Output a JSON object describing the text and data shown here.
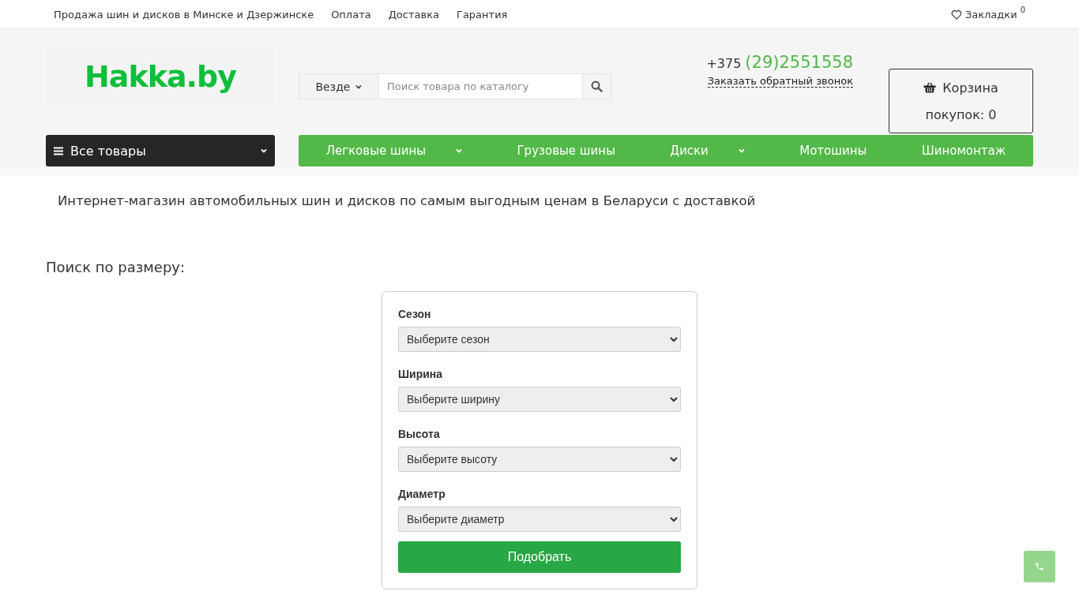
{
  "top_bar": {
    "links": [
      "Продажа шин и дисков в Минске и Дзержинске",
      "Оплата",
      "Доставка",
      "Гарантия"
    ],
    "bookmarks": {
      "label": "Закладки",
      "count": "0"
    }
  },
  "header": {
    "logo": "Hakka.by",
    "search": {
      "scope": "Везде",
      "placeholder": "Поиск товара по каталогу"
    },
    "phone": {
      "prefix": "+375",
      "number": "(29)2551558"
    },
    "callback_link": "Заказать обратный звонок",
    "cart": {
      "title": "Корзина",
      "count_text": "покупок: 0"
    }
  },
  "catalog_button": "Все товары",
  "nav": [
    {
      "label": "Легковые шины",
      "has_dropdown": true
    },
    {
      "label": "Грузовые шины",
      "has_dropdown": false
    },
    {
      "label": "Диски",
      "has_dropdown": true
    },
    {
      "label": "Мотошины",
      "has_dropdown": false
    },
    {
      "label": "Шиномонтаж",
      "has_dropdown": false
    }
  ],
  "headline": "Интернет-магазин автомобильных шин и дисков по самым выгодным ценам в Беларуси с доставкой",
  "size_search": {
    "title": "Поиск по размеру:",
    "fields": [
      {
        "label": "Сезон",
        "value": "Выберите сезон"
      },
      {
        "label": "Ширина",
        "value": "Выберите ширину"
      },
      {
        "label": "Высота",
        "value": "Выберите высоту"
      },
      {
        "label": "Диаметр",
        "value": "Выберите диаметр"
      }
    ],
    "submit": "Подобрать"
  }
}
